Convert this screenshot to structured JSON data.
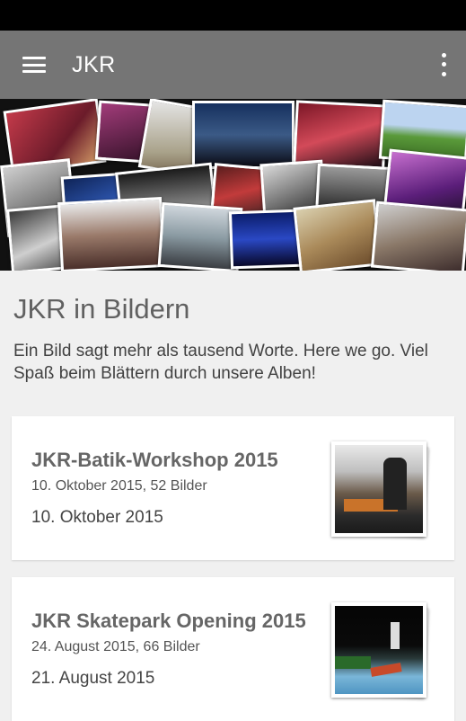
{
  "app_bar": {
    "title": "JKR",
    "menu_icon": "hamburger-menu-icon",
    "overflow_icon": "more-vert-icon",
    "color": "#757575"
  },
  "banner": {
    "alt": "collage-of-event-photos"
  },
  "section": {
    "title": "JKR in Bildern",
    "description": "Ein Bild sagt mehr als tausend Worte. Here we go. Viel Spaß beim Blättern durch unsere Alben!"
  },
  "albums": [
    {
      "title": "JKR-Batik-Workshop 2015",
      "subtitle": "10. Oktober 2015, 52 Bilder",
      "date": "10. Oktober 2015"
    },
    {
      "title": "JKR Skatepark Opening 2015",
      "subtitle": "24. August 2015, 66 Bilder",
      "date": "21. August 2015"
    }
  ]
}
